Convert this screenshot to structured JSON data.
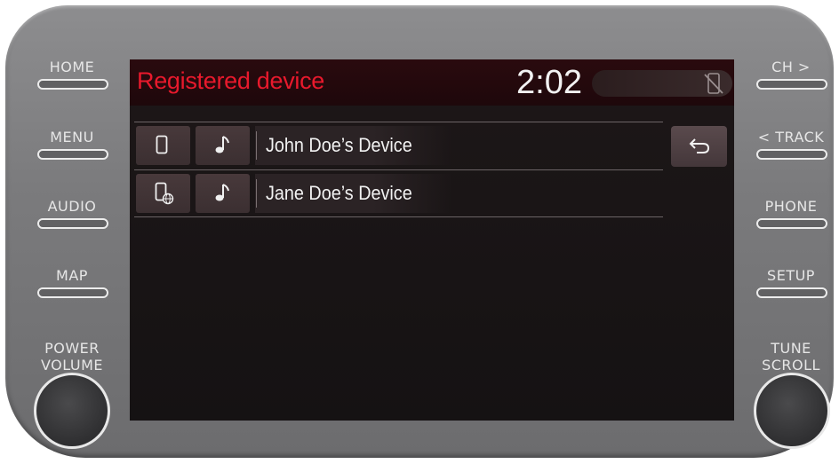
{
  "hardware": {
    "left_buttons": [
      {
        "label": "HOME"
      },
      {
        "label": "MENU"
      },
      {
        "label": "AUDIO"
      },
      {
        "label": "MAP"
      }
    ],
    "right_buttons": [
      {
        "label": "CH >"
      },
      {
        "label": "< TRACK"
      },
      {
        "label": "PHONE"
      },
      {
        "label": "SETUP"
      }
    ],
    "power_label_1": "POWER",
    "power_label_2": "VOLUME",
    "tune_label_1": "TUNE",
    "tune_label_2": "SCROLL"
  },
  "screen": {
    "title": "Registered device",
    "clock": "2:02",
    "accent_color": "#e8192c",
    "devices": [
      {
        "name": "John Doe’s Device",
        "phone_icon": "smartphone-icon",
        "audio_icon": "music-note-icon"
      },
      {
        "name": "Jane Doe’s Device",
        "phone_icon": "smartphone-globe-icon",
        "audio_icon": "music-note-icon"
      }
    ],
    "back_icon": "back-arrow-icon",
    "status_icon": "phone-disconnected-icon"
  }
}
